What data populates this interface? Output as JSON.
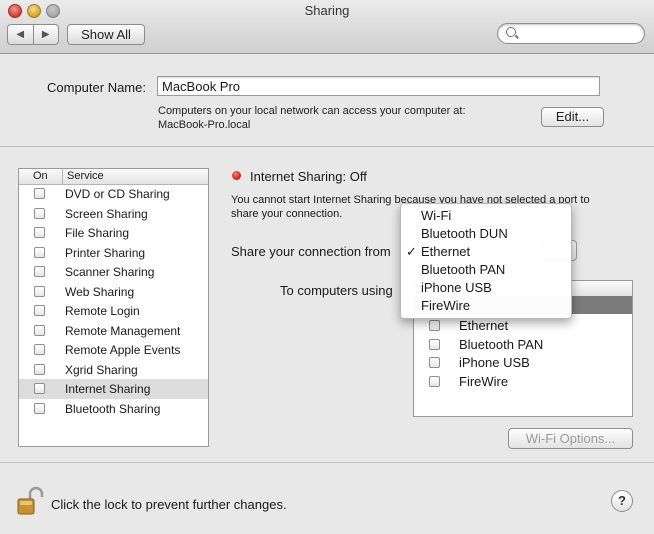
{
  "window": {
    "title": "Sharing",
    "show_all_label": "Show All",
    "search_placeholder": ""
  },
  "computer_name": {
    "label": "Computer Name:",
    "value": "MacBook Pro",
    "note_line1": "Computers on your local network can access your computer at:",
    "note_line2": "MacBook-Pro.local",
    "edit_label": "Edit..."
  },
  "services": {
    "header_on": "On",
    "header_service": "Service",
    "items": [
      {
        "name": "DVD or CD Sharing",
        "checked": false
      },
      {
        "name": "Screen Sharing",
        "checked": false
      },
      {
        "name": "File Sharing",
        "checked": false
      },
      {
        "name": "Printer Sharing",
        "checked": false
      },
      {
        "name": "Scanner Sharing",
        "checked": false
      },
      {
        "name": "Web Sharing",
        "checked": false
      },
      {
        "name": "Remote Login",
        "checked": false
      },
      {
        "name": "Remote Management",
        "checked": false
      },
      {
        "name": "Remote Apple Events",
        "checked": false
      },
      {
        "name": "Xgrid Sharing",
        "checked": false
      },
      {
        "name": "Internet Sharing",
        "checked": false,
        "selected": true
      },
      {
        "name": "Bluetooth Sharing",
        "checked": false
      }
    ]
  },
  "internet_sharing": {
    "status": "Internet Sharing: Off",
    "status_color": "#d2281c",
    "warning_line1": "You cannot start Internet Sharing because you have not selected a port to",
    "warning_line2": "share your connection.",
    "share_from_label": "Share your connection from",
    "to_computers_label": "To computers using",
    "dropdown": {
      "selected": "Ethernet",
      "options": [
        "Wi-Fi",
        "Bluetooth DUN",
        "Ethernet",
        "Bluetooth PAN",
        "iPhone USB",
        "FireWire"
      ]
    },
    "ports": [
      {
        "name": "Ethernet",
        "checked": false
      },
      {
        "name": "Bluetooth PAN",
        "checked": false
      },
      {
        "name": "iPhone USB",
        "checked": false
      },
      {
        "name": "FireWire",
        "checked": false
      }
    ],
    "wifi_options_label": "Wi-Fi Options..."
  },
  "footer": {
    "lock_text": "Click the lock to prevent further changes.",
    "help_label": "?"
  }
}
